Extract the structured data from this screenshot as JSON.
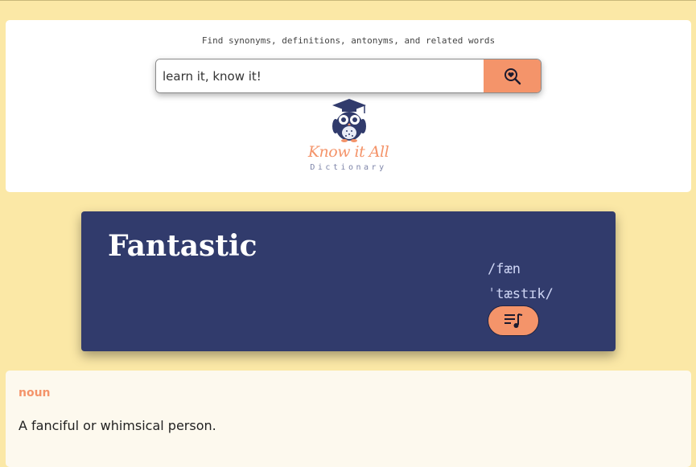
{
  "header": {
    "tagline": "Find synonyms, definitions, antonyms, and related words",
    "search": {
      "value": "learn it, know it!",
      "placeholder": ""
    },
    "search_icon": "heart-magnifier-icon",
    "logo": {
      "title": "Know it All",
      "subtitle": "Dictionary",
      "icon": "owl-graduate-icon"
    }
  },
  "word": {
    "title": "Fantastic",
    "phonetic_line1": "/fæn",
    "phonetic_line2": "ˈtæstɪk/",
    "audio_icon": "playlist-music-icon"
  },
  "definition": {
    "part_of_speech": "noun",
    "text": "A fanciful or whimsical person."
  },
  "colors": {
    "background": "#fbe8a6",
    "accent": "#f4946a",
    "word_card": "#313b6c",
    "definition_card": "#fdf9ee"
  }
}
